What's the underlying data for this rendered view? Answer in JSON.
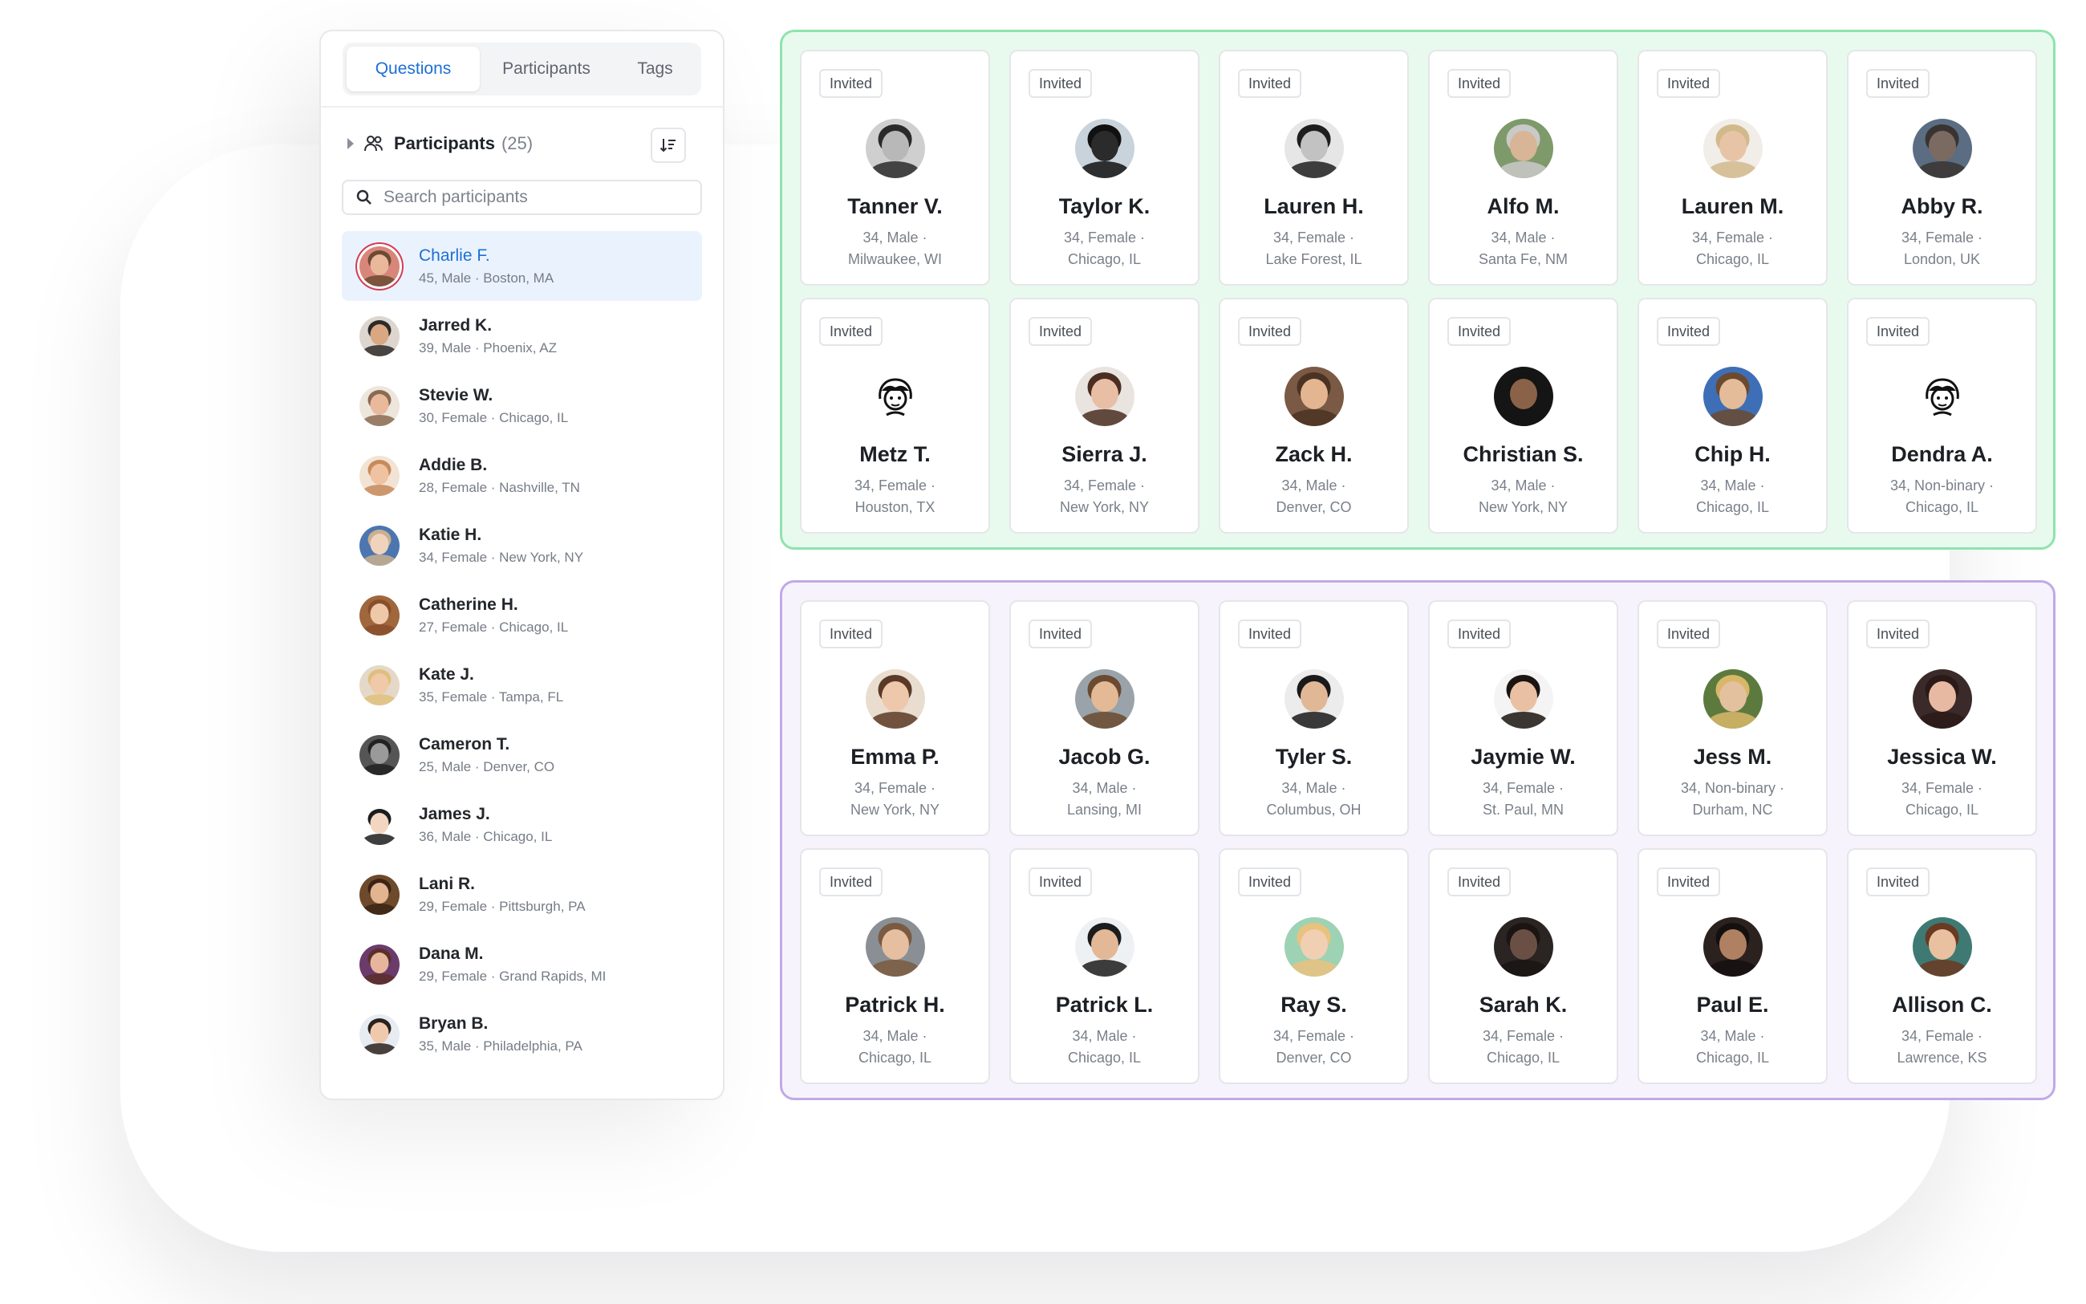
{
  "sidebar": {
    "tabs": [
      {
        "label": "Questions",
        "active": true
      },
      {
        "label": "Participants",
        "active": false
      },
      {
        "label": "Tags",
        "active": false
      }
    ],
    "header": {
      "title": "Participants",
      "count": "(25)"
    },
    "search": {
      "placeholder": "Search participants"
    },
    "participants": [
      {
        "name": "Charlie F.",
        "meta": "45, Male · Boston, MA",
        "active": true,
        "bg": "#d9867a",
        "skin": "#e9b79a",
        "hair": "#6b4a32"
      },
      {
        "name": "Jarred K.",
        "meta": "39, Male · Phoenix, AZ",
        "bg": "#dcd6cf",
        "skin": "#d9a882",
        "hair": "#2d2a28"
      },
      {
        "name": "Stevie W.",
        "meta": "30, Female · Chicago, IL",
        "bg": "#ede6dc",
        "skin": "#e9b99c",
        "hair": "#8a6a52"
      },
      {
        "name": "Addie B.",
        "meta": "28, Female · Nashville, TN",
        "bg": "#f2e4d4",
        "skin": "#efc2a1",
        "hair": "#c78a5a"
      },
      {
        "name": "Katie H.",
        "meta": "34, Female · New York, NY",
        "bg": "#4c76b0",
        "skin": "#f0d3bd",
        "hair": "#c9b090"
      },
      {
        "name": "Catherine H.",
        "meta": "27, Female · Chicago, IL",
        "bg": "#a0663c",
        "skin": "#efc8aa",
        "hair": "#8a4f2a"
      },
      {
        "name": "Kate J.",
        "meta": "35, Female · Tampa, FL",
        "bg": "#e4d9c8",
        "skin": "#f0c9a8",
        "hair": "#e0bf7d"
      },
      {
        "name": "Cameron T.",
        "meta": "25, Male · Denver, CO",
        "bg": "#555555",
        "skin": "#9a9a9a",
        "hair": "#222222"
      },
      {
        "name": "James J.",
        "meta": "36, Male · Chicago, IL",
        "bg": "#ffffff",
        "skin": "#f2d6c2",
        "hair": "#1c1c1c"
      },
      {
        "name": "Lani R.",
        "meta": "29, Female · Pittsburgh, PA",
        "bg": "#6d4a2b",
        "skin": "#e2b48f",
        "hair": "#3b2415"
      },
      {
        "name": "Dana M.",
        "meta": "29, Female · Grand Rapids, MI",
        "bg": "#6a3b6b",
        "skin": "#e6b59b",
        "hair": "#5a2f2a"
      },
      {
        "name": "Bryan B.",
        "meta": "35, Male · Philadelphia, PA",
        "bg": "#e7ecf2",
        "skin": "#efc9ac",
        "hair": "#2a221c"
      }
    ]
  },
  "groups": [
    {
      "name": "green",
      "cards": [
        {
          "badge": "Invited",
          "name": "Tanner V.",
          "meta1": "34, Male ·",
          "meta2": "Milwaukee, WI",
          "bg": "#cfcfcf",
          "skin": "#b8b8b8",
          "hair": "#2a2a2a"
        },
        {
          "badge": "Invited",
          "name": "Taylor K.",
          "meta1": "34, Female ·",
          "meta2": "Chicago, IL",
          "bg": "#c9d3dc",
          "skin": "#2b2b2b",
          "hair": "#111111"
        },
        {
          "badge": "Invited",
          "name": "Lauren H.",
          "meta1": "34, Female ·",
          "meta2": "Lake Forest, IL",
          "bg": "#e6e6e6",
          "skin": "#c2c2c2",
          "hair": "#1e1e1e"
        },
        {
          "badge": "Invited",
          "name": "Alfo M.",
          "meta1": "34, Male ·",
          "meta2": "Santa Fe, NM",
          "bg": "#7e9a6a",
          "skin": "#d7b596",
          "hair": "#c9c9c9"
        },
        {
          "badge": "Invited",
          "name": "Lauren M.",
          "meta1": "34, Female ·",
          "meta2": "Chicago, IL",
          "bg": "#f1ede8",
          "skin": "#e8c4a6",
          "hair": "#d2b98c"
        },
        {
          "badge": "Invited",
          "name": "Abby R.",
          "meta1": "34, Female ·",
          "meta2": "London, UK",
          "bg": "#5b6d82",
          "skin": "#7a6a62",
          "hair": "#3a3430"
        },
        {
          "badge": "Invited",
          "name": "Metz T.",
          "meta1": "34, Female ·",
          "meta2": "Houston, TX",
          "bg": "#ffffff",
          "skin": "#ffffff",
          "hair": "#111111",
          "sketch": true
        },
        {
          "badge": "Invited",
          "name": "Sierra J.",
          "meta1": "34, Female ·",
          "meta2": "New York, NY",
          "bg": "#e9e4df",
          "skin": "#e8bfa5",
          "hair": "#4a2e22"
        },
        {
          "badge": "Invited",
          "name": "Zack H.",
          "meta1": "34, Male ·",
          "meta2": "Denver, CO",
          "bg": "#7a5a44",
          "skin": "#e3b591",
          "hair": "#4a3322"
        },
        {
          "badge": "Invited",
          "name": "Christian S.",
          "meta1": "34, Male ·",
          "meta2": "New York, NY",
          "bg": "#151515",
          "skin": "#8a6248",
          "hair": "#141414"
        },
        {
          "badge": "Invited",
          "name": "Chip H.",
          "meta1": "34, Male ·",
          "meta2": "Chicago, IL",
          "bg": "#3e6fb6",
          "skin": "#e4bc99",
          "hair": "#6b4a30"
        },
        {
          "badge": "Invited",
          "name": "Dendra A.",
          "meta1": "34, Non-binary ·",
          "meta2": "Chicago, IL",
          "bg": "#ffffff",
          "skin": "#ffffff",
          "hair": "#111111",
          "sketch": true
        }
      ]
    },
    {
      "name": "purple",
      "cards": [
        {
          "badge": "Invited",
          "name": "Emma P.",
          "meta1": "34, Female ·",
          "meta2": "New York, NY",
          "bg": "#e9ddd0",
          "skin": "#eec8ab",
          "hair": "#5a3a26"
        },
        {
          "badge": "Invited",
          "name": "Jacob G.",
          "meta1": "34, Male ·",
          "meta2": "Lansing, MI",
          "bg": "#9aa3a9",
          "skin": "#e4b995",
          "hair": "#6a4a30"
        },
        {
          "badge": "Invited",
          "name": "Tyler S.",
          "meta1": "34, Male ·",
          "meta2": "Columbus, OH",
          "bg": "#ececec",
          "skin": "#e1b896",
          "hair": "#1a1a1a"
        },
        {
          "badge": "Invited",
          "name": "Jaymie W.",
          "meta1": "34, Female ·",
          "meta2": "St. Paul, MN",
          "bg": "#f4f4f4",
          "skin": "#e9c0a4",
          "hair": "#1b1410"
        },
        {
          "badge": "Invited",
          "name": "Jess M.",
          "meta1": "34, Non-binary ·",
          "meta2": "Durham, NC",
          "bg": "#5c7a3e",
          "skin": "#e3c09e",
          "hair": "#d8b768"
        },
        {
          "badge": "Invited",
          "name": "Jessica W.",
          "meta1": "34, Female ·",
          "meta2": "Chicago, IL",
          "bg": "#3a2a2a",
          "skin": "#e8b9a2",
          "hair": "#2b1a18"
        },
        {
          "badge": "Invited",
          "name": "Patrick H.",
          "meta1": "34, Male ·",
          "meta2": "Chicago, IL",
          "bg": "#8a8f95",
          "skin": "#e6bfa0",
          "hair": "#7a5a40"
        },
        {
          "badge": "Invited",
          "name": "Patrick L.",
          "meta1": "34, Male ·",
          "meta2": "Chicago, IL",
          "bg": "#eef1f4",
          "skin": "#e2b896",
          "hair": "#1c1c1c"
        },
        {
          "badge": "Invited",
          "name": "Ray S.",
          "meta1": "34, Female ·",
          "meta2": "Denver, CO",
          "bg": "#9ed2b4",
          "skin": "#f1cfb3",
          "hair": "#e9c27e"
        },
        {
          "badge": "Invited",
          "name": "Sarah K.",
          "meta1": "34, Female ·",
          "meta2": "Chicago, IL",
          "bg": "#2a2422",
          "skin": "#6a5044",
          "hair": "#1a1412"
        },
        {
          "badge": "Invited",
          "name": "Paul E.",
          "meta1": "34, Male ·",
          "meta2": "Chicago, IL",
          "bg": "#2b2220",
          "skin": "#b08062",
          "hair": "#151010"
        },
        {
          "badge": "Invited",
          "name": "Allison C.",
          "meta1": "34, Female ·",
          "meta2": "Lawrence, KS",
          "bg": "#3e7a73",
          "skin": "#e9c0a0",
          "hair": "#6a3a22"
        }
      ]
    }
  ],
  "colors": {
    "accent": "#1d6fd6",
    "green_border": "#8fe3ad",
    "green_fill": "#e8faee",
    "purple_border": "#c0a9e8",
    "purple_fill": "#f7f3fc",
    "active_row": "#eaf3fd"
  }
}
